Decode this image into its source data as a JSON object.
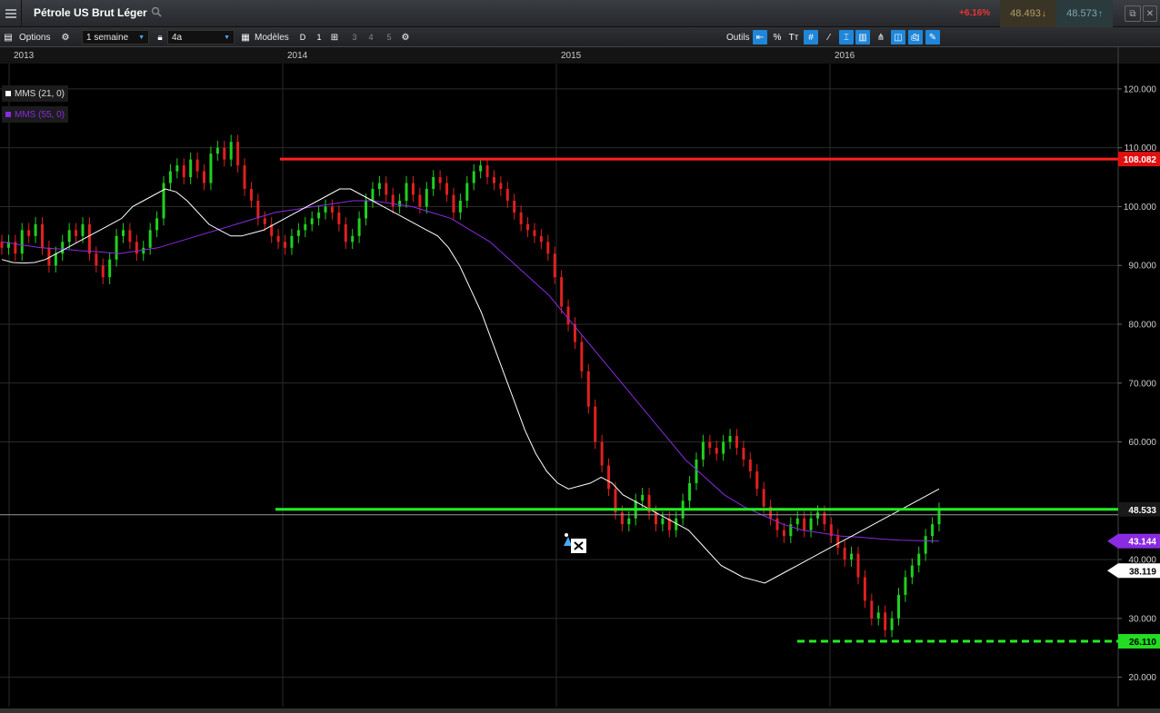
{
  "header": {
    "title": "Pétrole US Brut Léger",
    "change": "+6.16%",
    "sell_price": "48.493",
    "buy_price": "48.573"
  },
  "toolbar": {
    "options_label": "Options",
    "period": "1 semaine",
    "range": "4a",
    "models_label": "Modèles",
    "d_label": "D",
    "one_label": "1",
    "nums": [
      "3",
      "4",
      "5"
    ],
    "tools_label": "Outils",
    "percent_label": "%",
    "text_tool_label": "Tт"
  },
  "legend": [
    {
      "label": "MMS (21, 0)",
      "color": "#ffffff"
    },
    {
      "label": "MMS (55, 0)",
      "color": "#8a2be2"
    }
  ],
  "price_tags": {
    "resistance": "108.082",
    "current": "48.533",
    "ma55": "43.144",
    "ma21": "38.119",
    "support": "26.110"
  },
  "colors": {
    "up": "#20d020",
    "down": "#e02020",
    "ma21": "#ffffff",
    "ma55": "#8a2be2",
    "resistance": "#ff2020",
    "support": "#22ee22",
    "accent": "#1f86d9"
  },
  "chart_data": {
    "type": "candlestick",
    "title": "Pétrole US Brut Léger",
    "x_labels": [
      "2013",
      "2014",
      "2015",
      "2016"
    ],
    "y_ticks": [
      "120.000",
      "110.000",
      "100.000",
      "90.000",
      "80.000",
      "70.000",
      "60.000",
      "40.000",
      "30.000",
      "20.000"
    ],
    "ylim": [
      15,
      124
    ],
    "resistance_level": 108.082,
    "current_level": 48.533,
    "support_level": 26.11,
    "close_series": [
      93,
      94,
      92,
      96,
      95,
      97,
      93,
      90,
      92,
      94,
      96,
      95,
      97,
      92,
      90,
      88,
      91,
      95,
      96,
      94,
      92,
      93,
      96,
      98,
      104,
      106,
      107,
      105,
      108,
      106,
      104,
      109,
      110,
      108,
      111,
      107,
      103,
      101,
      98,
      97,
      95,
      94,
      93,
      95,
      96,
      97,
      98,
      99,
      100,
      99,
      97,
      94,
      95,
      98,
      101,
      103,
      104,
      102,
      100,
      101,
      104,
      102,
      100,
      103,
      105,
      104,
      102,
      99,
      101,
      104,
      106,
      107,
      105,
      104,
      103,
      101,
      99,
      97,
      96,
      95,
      94,
      92,
      88,
      83,
      80,
      77,
      72,
      66,
      60,
      56,
      52,
      48,
      46,
      47,
      50,
      51,
      48,
      46,
      47,
      45,
      47,
      50,
      53,
      57,
      60,
      59,
      58,
      60,
      61,
      59,
      57,
      55,
      52,
      49,
      47,
      45,
      44,
      46,
      47,
      45,
      47,
      48,
      46,
      44,
      42,
      40,
      41,
      37,
      33,
      30,
      31,
      28,
      30,
      34,
      37,
      39,
      41,
      44,
      46,
      48.5
    ],
    "ma21_series": [
      91,
      90.5,
      90.4,
      90.5,
      91,
      92,
      93,
      94,
      95,
      96,
      97,
      98,
      100,
      101,
      102,
      103,
      102.5,
      101,
      99,
      97,
      96,
      95,
      95,
      95.5,
      96,
      97,
      98,
      99,
      100,
      101,
      102,
      103,
      103,
      102,
      101,
      100,
      99,
      98,
      97,
      96,
      95,
      93,
      90,
      86,
      82,
      77,
      72,
      67,
      62,
      58,
      55,
      53,
      52,
      52.5,
      53,
      54,
      53,
      51,
      50,
      49,
      48,
      47,
      46,
      45,
      43,
      41,
      39,
      38,
      37,
      36.5,
      36,
      37,
      38,
      39,
      40,
      41,
      42,
      43,
      44,
      45,
      46,
      47,
      48,
      49,
      50,
      51,
      52
    ],
    "ma55_series": [
      94,
      93.5,
      93,
      92.8,
      92.5,
      92.3,
      92,
      92.5,
      93,
      94,
      95,
      96,
      97,
      98,
      99,
      99.5,
      100,
      100.5,
      101,
      101,
      100.5,
      100,
      99,
      98,
      96,
      94,
      91,
      88,
      85,
      81,
      77,
      73,
      69,
      65,
      61,
      57,
      54,
      51,
      49,
      47.5,
      46,
      45,
      44.5,
      44,
      43.8,
      43.5,
      43.3,
      43.2,
      43.144
    ]
  }
}
